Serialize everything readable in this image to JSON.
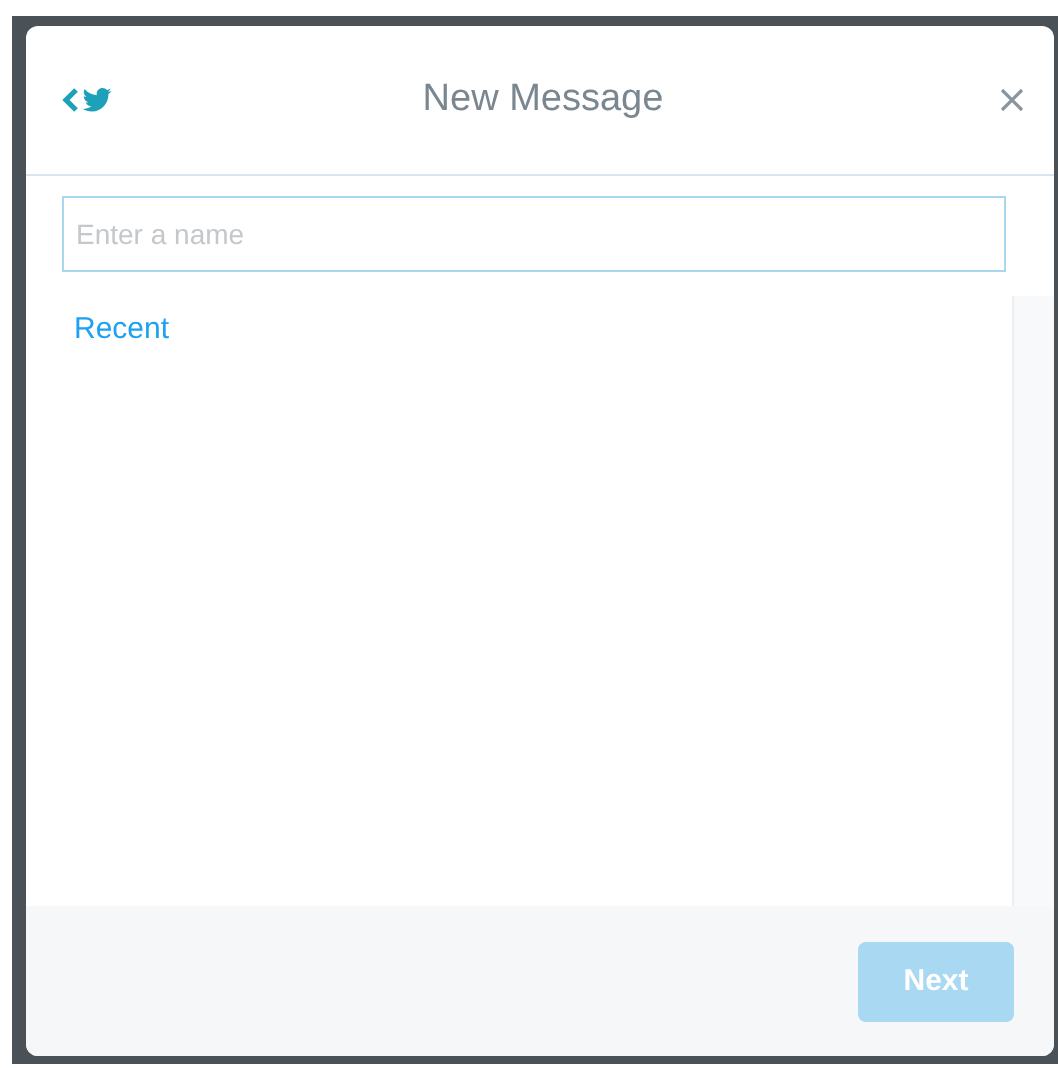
{
  "dialog": {
    "title": "New Message",
    "recipient_field": {
      "placeholder": "Enter a name"
    },
    "section_heading": "Recent",
    "next_button": {
      "label": "Next",
      "disabled": true
    }
  }
}
